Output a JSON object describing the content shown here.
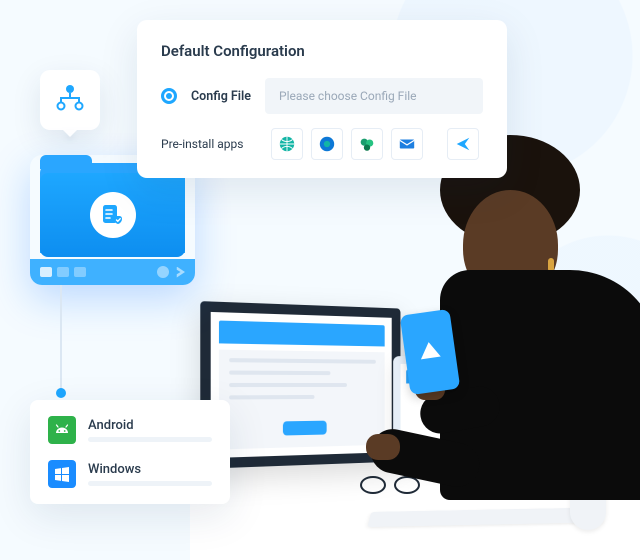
{
  "panel": {
    "title": "Default Configuration",
    "config_radio_label": "Config File",
    "config_placeholder": "Please choose Config File",
    "preinstall_label": "Pre-install apps",
    "apps": [
      {
        "name": "browser-globe",
        "color": "#12b5a5"
      },
      {
        "name": "airdroid-circle",
        "color": "#0d78d6"
      },
      {
        "name": "sharepoint",
        "color": "#1a9e6e"
      },
      {
        "name": "mail",
        "color": "#1e7fe0"
      },
      {
        "name": "send",
        "color": "#1ea7ff"
      }
    ]
  },
  "platforms": {
    "items": [
      {
        "name": "Android"
      },
      {
        "name": "Windows"
      }
    ]
  },
  "icons": {
    "hierarchy": "hierarchy-icon",
    "checklist": "checklist-shield-icon"
  }
}
